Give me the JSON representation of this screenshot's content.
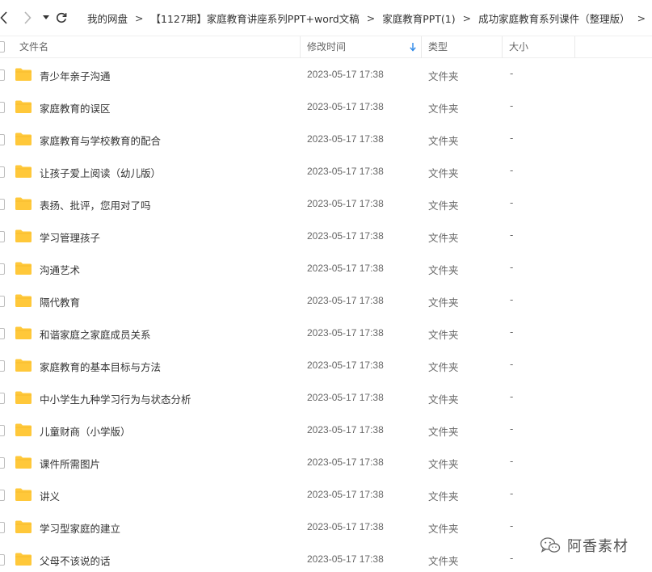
{
  "nav": {
    "breadcrumbs": [
      "我的网盘",
      "【1127期】家庭教育讲座系列PPT+word文稿",
      "家庭教育PPT(1)",
      "成功家庭教育系列课件（整理版）"
    ],
    "separator": ">"
  },
  "columns": {
    "name": "文件名",
    "modified": "修改时间",
    "type": "类型",
    "size": "大小"
  },
  "files": [
    {
      "name": "青少年亲子沟通",
      "modified": "2023-05-17 17:38",
      "type": "文件夹",
      "size": "-"
    },
    {
      "name": "家庭教育的误区",
      "modified": "2023-05-17 17:38",
      "type": "文件夹",
      "size": "-"
    },
    {
      "name": "家庭教育与学校教育的配合",
      "modified": "2023-05-17 17:38",
      "type": "文件夹",
      "size": "-"
    },
    {
      "name": "让孩子爱上阅读（幼儿版）",
      "modified": "2023-05-17 17:38",
      "type": "文件夹",
      "size": "-"
    },
    {
      "name": "表扬、批评，您用对了吗",
      "modified": "2023-05-17 17:38",
      "type": "文件夹",
      "size": "-"
    },
    {
      "name": "学习管理孩子",
      "modified": "2023-05-17 17:38",
      "type": "文件夹",
      "size": "-"
    },
    {
      "name": "沟通艺术",
      "modified": "2023-05-17 17:38",
      "type": "文件夹",
      "size": "-"
    },
    {
      "name": "隔代教育",
      "modified": "2023-05-17 17:38",
      "type": "文件夹",
      "size": "-"
    },
    {
      "name": "和谐家庭之家庭成员关系",
      "modified": "2023-05-17 17:38",
      "type": "文件夹",
      "size": "-"
    },
    {
      "name": "家庭教育的基本目标与方法",
      "modified": "2023-05-17 17:38",
      "type": "文件夹",
      "size": "-"
    },
    {
      "name": "中小学生九种学习行为与状态分析",
      "modified": "2023-05-17 17:38",
      "type": "文件夹",
      "size": "-"
    },
    {
      "name": "儿童财商（小学版）",
      "modified": "2023-05-17 17:38",
      "type": "文件夹",
      "size": "-"
    },
    {
      "name": "课件所需图片",
      "modified": "2023-05-17 17:38",
      "type": "文件夹",
      "size": "-"
    },
    {
      "name": "讲义",
      "modified": "2023-05-17 17:38",
      "type": "文件夹",
      "size": "-"
    },
    {
      "name": "学习型家庭的建立",
      "modified": "2023-05-17 17:38",
      "type": "文件夹",
      "size": "-"
    },
    {
      "name": "父母不该说的话",
      "modified": "2023-05-17 17:38",
      "type": "文件夹",
      "size": "-"
    }
  ],
  "watermark": {
    "text": "阿香素材",
    "icon": "wechat-icon"
  },
  "icons": {
    "back": "chevron-left-icon",
    "forward": "chevron-right-icon",
    "dropdown": "caret-down-icon",
    "refresh": "refresh-icon",
    "folder": "folder-icon",
    "sort": "sort-down-arrow-icon"
  },
  "colors": {
    "folder": "#FFC83A",
    "sort_arrow": "#2B87E8",
    "text": "#333333",
    "muted": "#666666"
  }
}
